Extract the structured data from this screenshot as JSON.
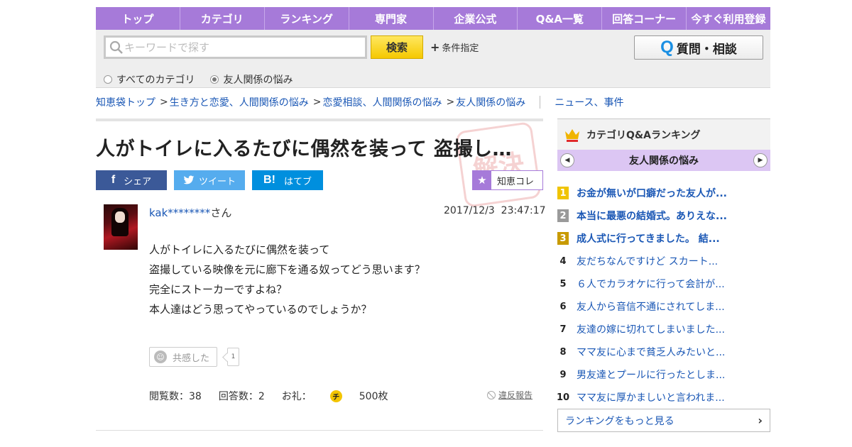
{
  "nav": [
    "トップ",
    "カテゴリ",
    "ランキング",
    "専門家",
    "企業公式",
    "Q&A一覧",
    "回答コーナー",
    "今すぐ利用登録"
  ],
  "search": {
    "placeholder": "キーワードで探す",
    "button": "検索",
    "condition": "条件指定",
    "scope_all": "すべてのカテゴリ",
    "scope_current": "友人関係の悩み",
    "selected_scope": "友人関係の悩み"
  },
  "ask_button": {
    "q": "Q",
    "label": "質問・相談"
  },
  "breadcrumbs": [
    "知恵袋トップ",
    "生き方と恋愛、人間関係の悩み",
    "恋愛相談、人間関係の悩み",
    "友人関係の悩み"
  ],
  "breadcrumb_sep": ">",
  "related_link": "ニュース、事件",
  "question": {
    "title": "人がトイレに入るたびに偶然を装って 盗撮し…",
    "user": "kak********",
    "user_suffix": "さん",
    "date": "2017/12/3  23:47:17",
    "body": [
      "人がトイレに入るたびに偶然を装って",
      "盗撮している映像を元に廊下を通る奴ってどう思います？",
      "完全にストーカーですよね？",
      "本人達はどう思ってやっているのでしょうか？"
    ],
    "empathy_label": "共感した",
    "empathy_count": "1",
    "views_label": "閲覧数：38",
    "answers_label": "回答数：2",
    "reward_label": "お礼：",
    "reward_coin": "チ",
    "reward_value": "500枚",
    "report_label": "違反報告"
  },
  "share": {
    "facebook": {
      "icon": "f",
      "label": "シェア",
      "color": "#3b5998"
    },
    "twitter": {
      "icon": "t",
      "label": "ツイート",
      "color": "#55acee"
    },
    "hatena": {
      "icon": "B!",
      "label": "はてブ",
      "color": "#008fde"
    },
    "chiekore": "知恵コレ"
  },
  "ranking": {
    "title": "カテゴリQ&Aランキング",
    "category": "友人関係の悩み",
    "items": [
      {
        "rank": "1",
        "text": "お金が無いが口癖だった友人が..."
      },
      {
        "rank": "2",
        "text": "本当に最悪の結婚式。ありえな..."
      },
      {
        "rank": "3",
        "text": "成人式に行ってきました。 結..."
      },
      {
        "rank": "4",
        "text": "友だちなんですけど スカート..."
      },
      {
        "rank": "5",
        "text": "６人でカラオケに行って会計が..."
      },
      {
        "rank": "6",
        "text": "友人から音信不通にされてしま..."
      },
      {
        "rank": "7",
        "text": "友達の嫁に切れてしまいました..."
      },
      {
        "rank": "8",
        "text": "ママ友に心まで貧乏人みたいと..."
      },
      {
        "rank": "9",
        "text": "男友達とプールに行ったとしま..."
      },
      {
        "rank": "10",
        "text": "ママ友に厚かましいと言われま..."
      }
    ],
    "more": "ランキングをもっと見る"
  },
  "colors": {
    "nav": "#a67ad9",
    "link": "#1a57b5",
    "search_button": "#f5c800",
    "rank_band": "#dcc6f3"
  }
}
